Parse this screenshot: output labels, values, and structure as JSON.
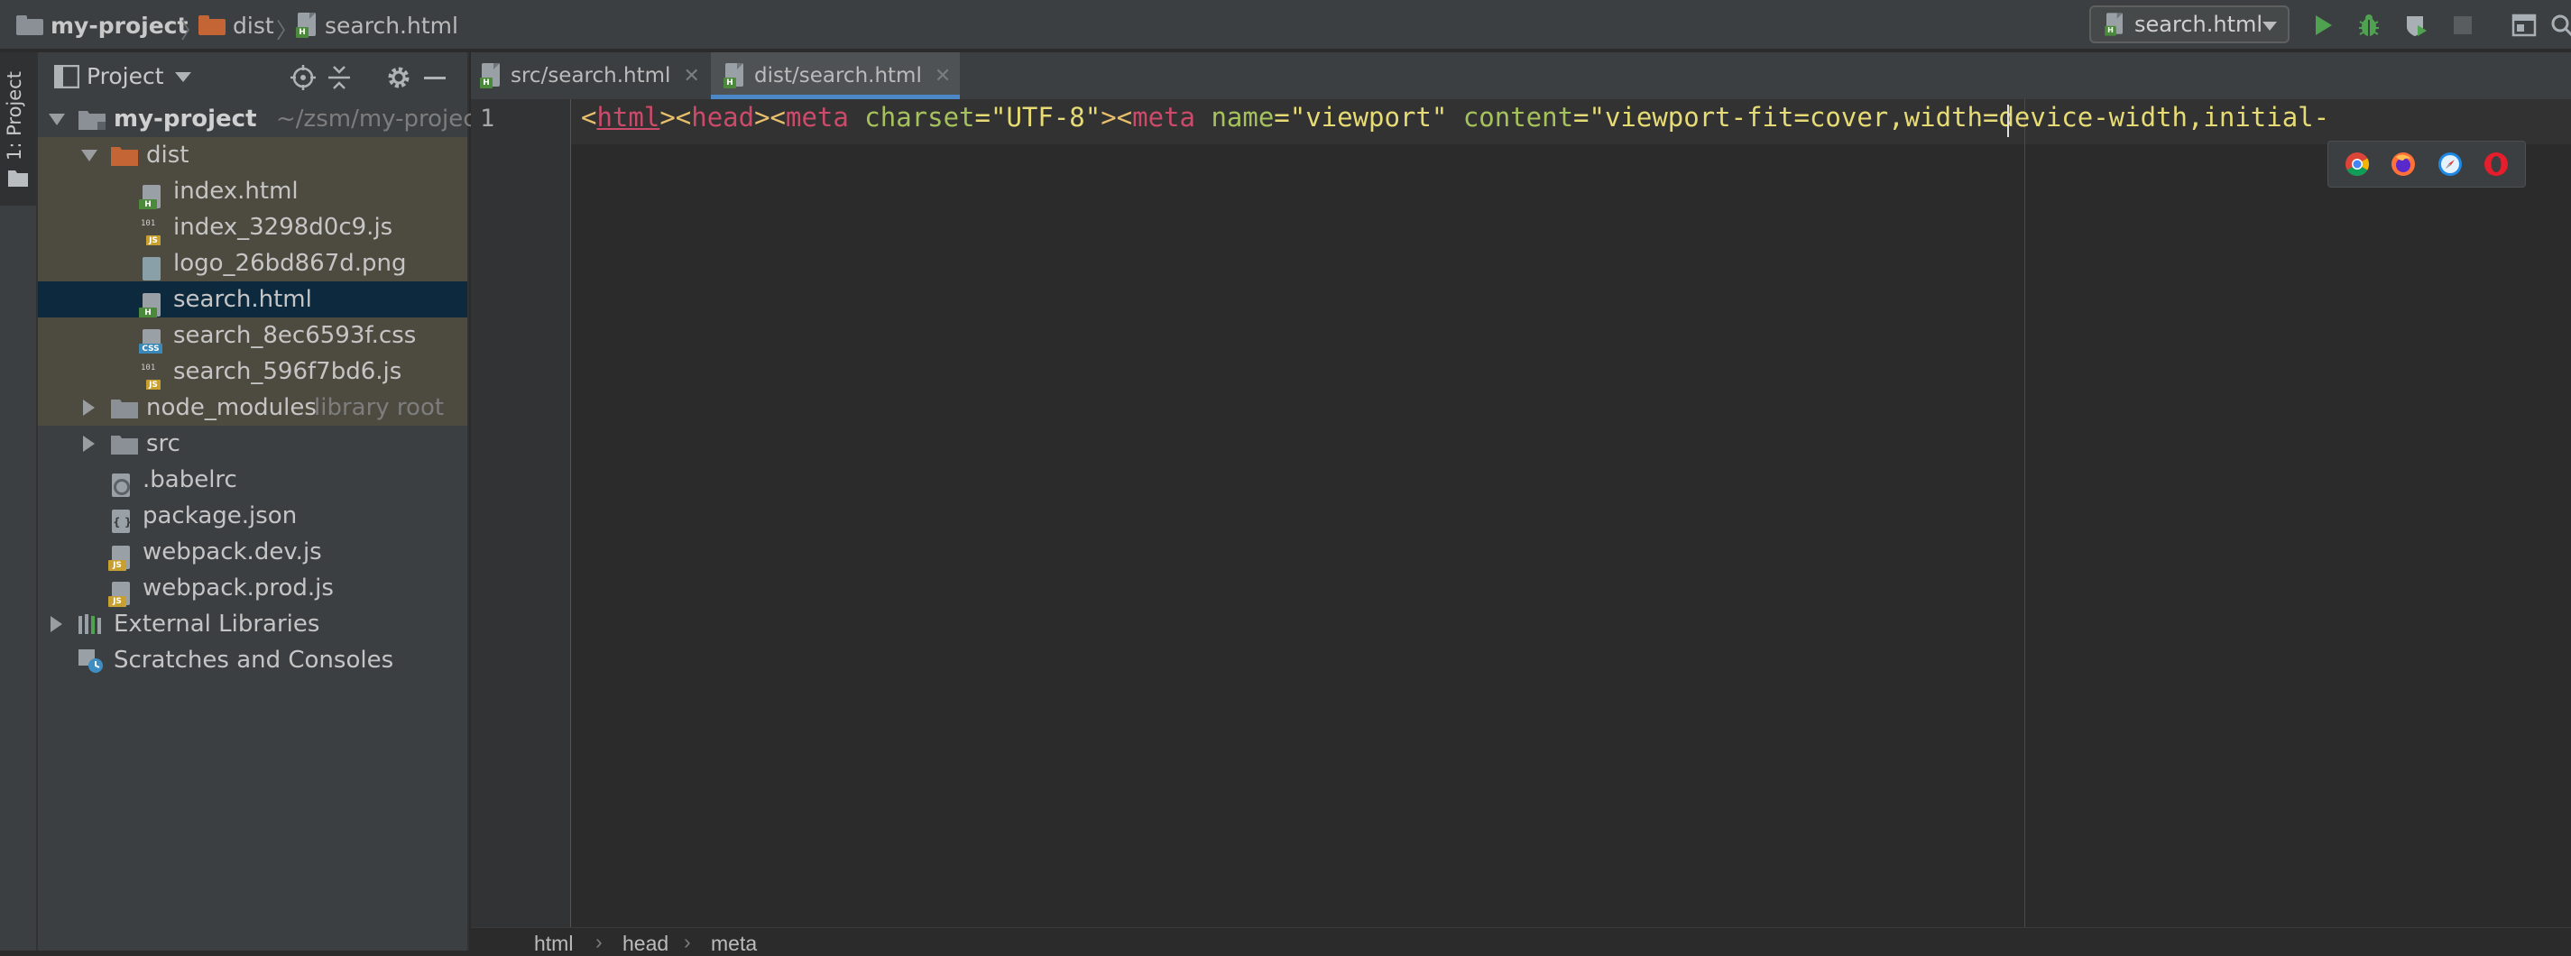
{
  "navbar": {
    "breadcrumbs": [
      {
        "label": "my-project",
        "icon": "folder-grey"
      },
      {
        "label": "dist",
        "icon": "folder-orange"
      },
      {
        "label": "search.html",
        "icon": "html-file"
      }
    ],
    "run_config": "search.html",
    "toolbar_icons": [
      "run-icon",
      "debug-icon",
      "coverage-icon",
      "stop-icon",
      "window-icon",
      "search-icon"
    ]
  },
  "tool_strip": {
    "project_label": "1: Project"
  },
  "project_panel": {
    "title": "Project",
    "header_icons": [
      "locate-icon",
      "collapse-icon",
      "gear-icon",
      "hide-icon"
    ],
    "tree": [
      {
        "label": "my-project",
        "hint": "~/zsm/my-project",
        "type": "folder-root"
      },
      {
        "label": "dist",
        "type": "folder-orange"
      },
      {
        "label": "index.html",
        "type": "html"
      },
      {
        "label": "index_3298d0c9.js",
        "type": "js-bin"
      },
      {
        "label": "logo_26bd867d.png",
        "type": "image"
      },
      {
        "label": "search.html",
        "type": "html"
      },
      {
        "label": "search_8ec6593f.css",
        "type": "css"
      },
      {
        "label": "search_596f7bd6.js",
        "type": "js-bin"
      },
      {
        "label": "node_modules",
        "hint": "library root",
        "type": "folder"
      },
      {
        "label": "src",
        "type": "folder"
      },
      {
        "label": ".babelrc",
        "type": "config"
      },
      {
        "label": "package.json",
        "type": "json"
      },
      {
        "label": "webpack.dev.js",
        "type": "js"
      },
      {
        "label": "webpack.prod.js",
        "type": "js"
      },
      {
        "label": "External Libraries",
        "type": "libraries"
      },
      {
        "label": "Scratches and Consoles",
        "type": "scratches"
      }
    ]
  },
  "editor": {
    "tabs": [
      {
        "label": "src/search.html",
        "active": false
      },
      {
        "label": "dist/search.html",
        "active": true
      }
    ],
    "line_number": "1",
    "code": {
      "t1": "<",
      "t2": "html",
      "t3": "><",
      "t4": "head",
      "t5": "><",
      "t6": "meta",
      "t7": " charset",
      "t8": "=\"UTF-8\"",
      "t9": "><",
      "t10": "meta",
      "t11": " name",
      "t12": "=\"viewport\"",
      "t13": " content",
      "t14": "=\"viewport-fit=cover,width=device-width,initial-"
    },
    "browsers": [
      "chrome-icon",
      "firefox-icon",
      "safari-icon",
      "opera-icon"
    ],
    "breadcrumbs": [
      "html",
      "head",
      "meta"
    ]
  },
  "colors": {
    "accent": "#4a88c7",
    "selection": "#0d293e",
    "excluded": "#4d4a40"
  }
}
